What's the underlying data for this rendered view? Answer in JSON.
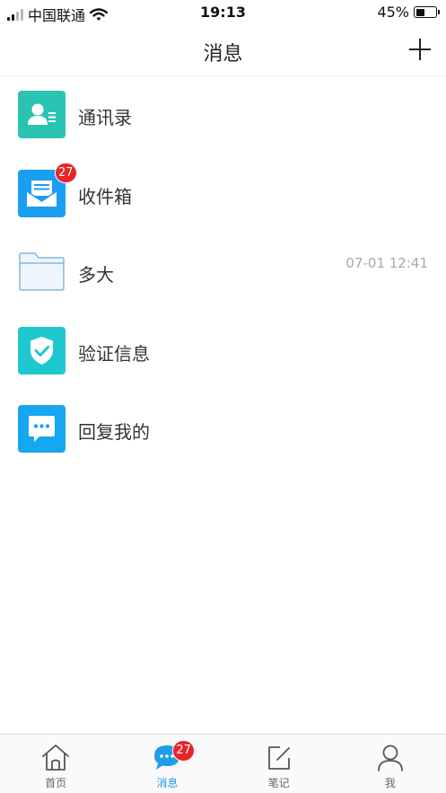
{
  "status_bar": {
    "carrier": "中国联通",
    "time": "19:13",
    "battery_percent": "45%",
    "battery_level": 0.45,
    "signal_bars": 2
  },
  "nav": {
    "title": "消息",
    "add_icon": "plus-icon"
  },
  "list": {
    "items": [
      {
        "label": "通讯录",
        "icon": "contacts-icon",
        "icon_color": "#2bc3b2"
      },
      {
        "label": "收件箱",
        "icon": "inbox-icon",
        "icon_color": "#199ef2",
        "badge": "27"
      },
      {
        "label": "多大",
        "icon": "folder-icon",
        "time": "07-01 12:41"
      },
      {
        "label": "验证信息",
        "icon": "shield-check-icon",
        "icon_color": "#1fc8d0"
      },
      {
        "label": "回复我的",
        "icon": "chat-bubble-icon",
        "icon_color": "#17a6f0"
      }
    ]
  },
  "tab_bar": {
    "tabs": [
      {
        "label": "首页",
        "icon": "home-icon"
      },
      {
        "label": "消息",
        "icon": "message-icon",
        "badge": "27",
        "active": true
      },
      {
        "label": "笔记",
        "icon": "note-edit-icon"
      },
      {
        "label": "我",
        "icon": "profile-icon"
      }
    ]
  },
  "colors": {
    "accent": "#1e9de8",
    "badge": "#e8242a"
  }
}
